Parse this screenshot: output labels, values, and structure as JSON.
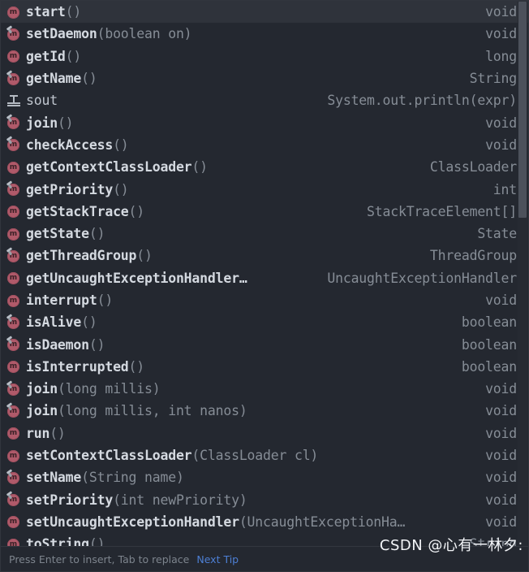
{
  "popup": {
    "kind": "code-completion-popup",
    "colors": {
      "background": "#242830",
      "selected_row": "#2f333b",
      "method_name": "#d4d9e0",
      "parameter_text": "#868d96",
      "return_type": "#868d96",
      "method_icon": "#b05a6a",
      "link": "#4d7fd4",
      "scrollbar_thumb": "#4c515b"
    },
    "selected_index": 0
  },
  "items": [
    {
      "icon": "method-icon",
      "inherited": false,
      "name": "start",
      "params": "()",
      "type": "void"
    },
    {
      "icon": "method-icon",
      "inherited": true,
      "name": "setDaemon",
      "params": "(boolean on)",
      "type": "void"
    },
    {
      "icon": "method-icon",
      "inherited": false,
      "name": "getId",
      "params": "()",
      "type": "long"
    },
    {
      "icon": "method-icon",
      "inherited": true,
      "name": "getName",
      "params": "()",
      "type": "String"
    },
    {
      "icon": "live-template-icon",
      "inherited": false,
      "name": "sout",
      "params": "",
      "type": "System.out.println(expr)"
    },
    {
      "icon": "method-icon",
      "inherited": true,
      "name": "join",
      "params": "()",
      "type": "void"
    },
    {
      "icon": "method-icon",
      "inherited": true,
      "name": "checkAccess",
      "params": "()",
      "type": "void"
    },
    {
      "icon": "method-icon",
      "inherited": false,
      "name": "getContextClassLoader",
      "params": "()",
      "type": "ClassLoader"
    },
    {
      "icon": "method-icon",
      "inherited": true,
      "name": "getPriority",
      "params": "()",
      "type": "int"
    },
    {
      "icon": "method-icon",
      "inherited": false,
      "name": "getStackTrace",
      "params": "()",
      "type": "StackTraceElement[]"
    },
    {
      "icon": "method-icon",
      "inherited": false,
      "name": "getState",
      "params": "()",
      "type": "State"
    },
    {
      "icon": "method-icon",
      "inherited": true,
      "name": "getThreadGroup",
      "params": "()",
      "type": "ThreadGroup"
    },
    {
      "icon": "method-icon",
      "inherited": false,
      "name": "getUncaughtExceptionHandler…",
      "params": "",
      "type": "UncaughtExceptionHandler"
    },
    {
      "icon": "method-icon",
      "inherited": false,
      "name": "interrupt",
      "params": "()",
      "type": "void"
    },
    {
      "icon": "method-icon",
      "inherited": true,
      "name": "isAlive",
      "params": "()",
      "type": "boolean"
    },
    {
      "icon": "method-icon",
      "inherited": true,
      "name": "isDaemon",
      "params": "()",
      "type": "boolean"
    },
    {
      "icon": "method-icon",
      "inherited": false,
      "name": "isInterrupted",
      "params": "()",
      "type": "boolean"
    },
    {
      "icon": "method-icon",
      "inherited": true,
      "name": "join",
      "params": "(long millis)",
      "type": "void"
    },
    {
      "icon": "method-icon",
      "inherited": true,
      "name": "join",
      "params": "(long millis, int nanos)",
      "type": "void"
    },
    {
      "icon": "method-icon",
      "inherited": false,
      "name": "run",
      "params": "()",
      "type": "void"
    },
    {
      "icon": "method-icon",
      "inherited": false,
      "name": "setContextClassLoader",
      "params": "(ClassLoader cl)",
      "type": "void"
    },
    {
      "icon": "method-icon",
      "inherited": true,
      "name": "setName",
      "params": "(String name)",
      "type": "void"
    },
    {
      "icon": "method-icon",
      "inherited": true,
      "name": "setPriority",
      "params": "(int newPriority)",
      "type": "void"
    },
    {
      "icon": "method-icon",
      "inherited": false,
      "name": "setUncaughtExceptionHandler",
      "params": "(UncaughtExceptionHa…",
      "type": "void"
    },
    {
      "icon": "method-icon",
      "inherited": false,
      "name": "toString",
      "params": "()",
      "type": "String"
    }
  ],
  "statusbar": {
    "hint": "Press Enter to insert, Tab to replace",
    "next_tip": "Next Tip"
  },
  "watermark": {
    "text": "CSDN @心有一林夕:"
  },
  "method_icon_letter": "m"
}
